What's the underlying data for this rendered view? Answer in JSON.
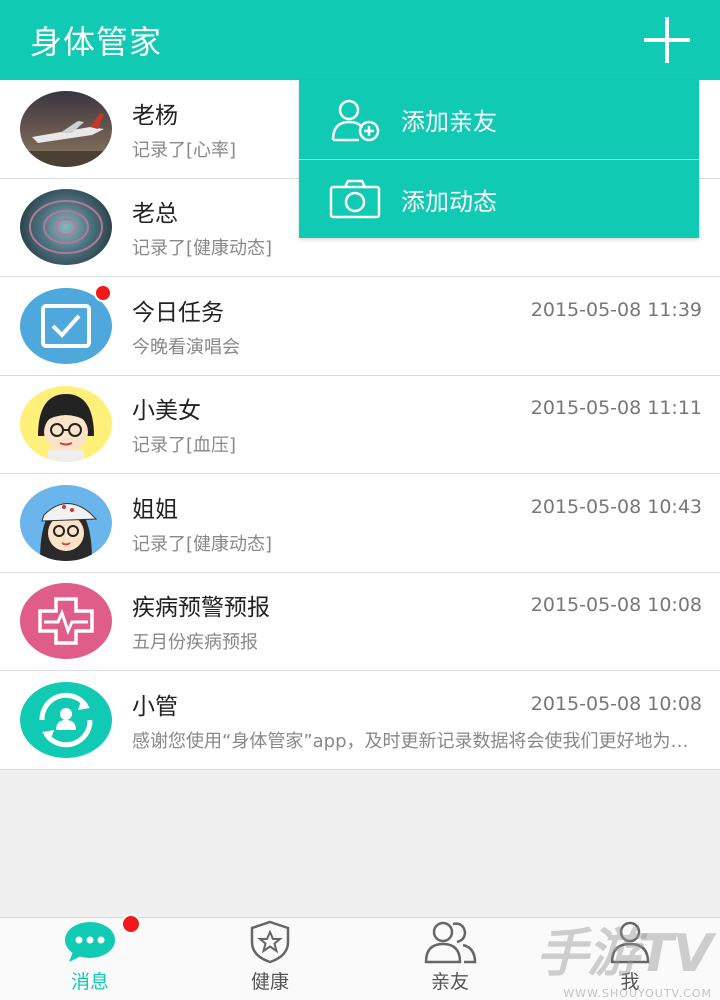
{
  "header": {
    "title": "身体管家",
    "add_icon": "plus-icon"
  },
  "menu": {
    "items": [
      {
        "label": "添加亲友",
        "icon": "add-friend-icon"
      },
      {
        "label": "添加动态",
        "icon": "camera-icon"
      }
    ]
  },
  "list": [
    {
      "name": "老杨",
      "sub": "记录了[心率]",
      "time": "",
      "avatar": "airplane-photo",
      "badge": false
    },
    {
      "name": "老总",
      "sub": "记录了[健康动态]",
      "time": "",
      "avatar": "succulent-photo",
      "badge": false
    },
    {
      "name": "今日任务",
      "sub": "今晚看演唱会",
      "time": "2015-05-08 11:39",
      "avatar": "checkbox-icon",
      "badge": true
    },
    {
      "name": "小美女",
      "sub": "记录了[血压]",
      "time": "2015-05-08 11:11",
      "avatar": "cartoon-girl-glasses",
      "badge": false
    },
    {
      "name": "姐姐",
      "sub": "记录了[健康动态]",
      "time": "2015-05-08 10:43",
      "avatar": "cartoon-girl-cap",
      "badge": false
    },
    {
      "name": "疾病预警预报",
      "sub": "五月份疾病预报",
      "time": "2015-05-08 10:08",
      "avatar": "medical-cross-icon",
      "badge": false
    },
    {
      "name": "小管",
      "sub": "感谢您使用“身体管家”app，及时更新记录数据将会使我们更好地为您服务",
      "time": "2015-05-08 10:08",
      "avatar": "assistant-icon",
      "badge": false
    }
  ],
  "tabs": [
    {
      "label": "消息",
      "icon": "chat-icon",
      "active": true,
      "badge": true
    },
    {
      "label": "健康",
      "icon": "shield-star-icon",
      "active": false,
      "badge": false
    },
    {
      "label": "亲友",
      "icon": "friends-icon",
      "active": false,
      "badge": false
    },
    {
      "label": "我",
      "icon": "person-icon",
      "active": false,
      "badge": false
    }
  ],
  "watermark": {
    "main": "手游TV",
    "sub": "WWW.SHOUYOUTV.COM"
  },
  "colors": {
    "primary": "#10cab4",
    "badge": "#f01818",
    "text": "#222222",
    "subtext": "#888888"
  }
}
